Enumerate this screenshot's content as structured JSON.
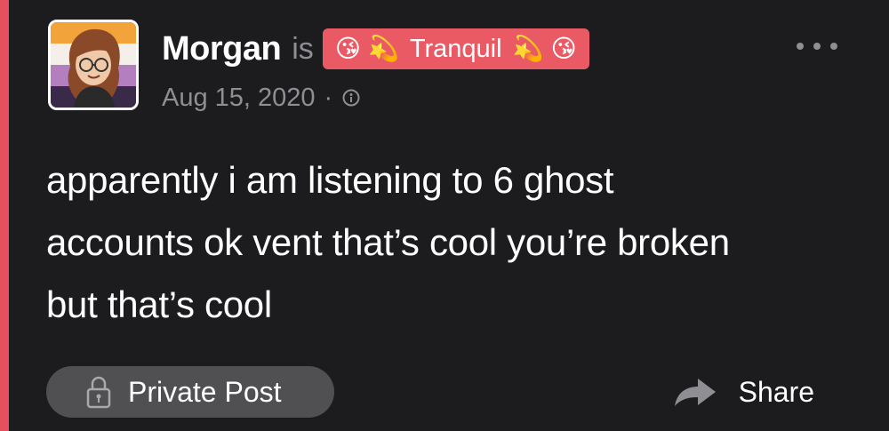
{
  "post": {
    "author": "Morgan",
    "is_text": "is",
    "mood": {
      "emoji_left": [
        "😘",
        "💫"
      ],
      "label": "Tranquil",
      "emoji_right": [
        "💫",
        "😘"
      ],
      "badge_color": "#ea5a64"
    },
    "date": "Aug 15, 2020",
    "separator": "·",
    "visibility_icon": "info-circle-icon",
    "body": "apparently i am listening to 6 ghost accounts ok vent that’s cool you’re broken but that’s cool",
    "more_icon": "more-dots-icon"
  },
  "footer": {
    "private_label": "Private Post",
    "private_icon": "lock-icon",
    "share_label": "Share",
    "share_icon": "share-arrow-icon"
  },
  "colors": {
    "background": "#1c1c1e",
    "accent_bar": "#e5505e",
    "muted_text": "#8e8e93",
    "pill_background": "#505052"
  }
}
